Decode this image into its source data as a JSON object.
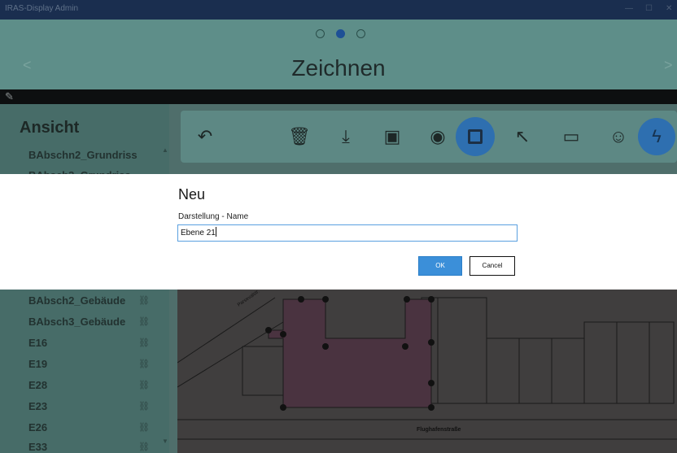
{
  "window": {
    "title": "IRAS-Display Admin",
    "controls": [
      "—",
      "☐",
      "✕"
    ]
  },
  "header": {
    "title": "Zeichnen",
    "pager": {
      "count": 3,
      "active_index": 1
    },
    "prev_label": "<",
    "next_label": ">"
  },
  "toolbar_strip": {
    "icon": "pencil-icon"
  },
  "sidebar": {
    "title": "Ansicht",
    "items": [
      {
        "label": "BAbschn2_Grundriss",
        "linked": false
      },
      {
        "label": "BAbsch3_Grundriss",
        "linked": false
      },
      {
        "label": "BAbsch2_Gebäude",
        "linked": true
      },
      {
        "label": "BAbsch3_Gebäude",
        "linked": true
      },
      {
        "label": "E16",
        "linked": true
      },
      {
        "label": "E19",
        "linked": true
      },
      {
        "label": "E28",
        "linked": true
      },
      {
        "label": "E23",
        "linked": true
      },
      {
        "label": "E26",
        "linked": true
      },
      {
        "label": "E33",
        "linked": true
      }
    ]
  },
  "tools": [
    {
      "name": "undo-icon",
      "active": false
    },
    {
      "name": "trash-icon",
      "active": false
    },
    {
      "name": "save-down-icon",
      "active": false
    },
    {
      "name": "save-icon",
      "active": false
    },
    {
      "name": "point-icon",
      "active": false
    },
    {
      "name": "rectangle-icon",
      "active": true
    },
    {
      "name": "pointer-arrow-icon",
      "active": false
    },
    {
      "name": "image-icon",
      "active": false
    },
    {
      "name": "palette-icon",
      "active": false
    },
    {
      "name": "lightning-icon",
      "active": true
    }
  ],
  "floorplan": {
    "street_label": "Flughafenstraße",
    "street_label_2": "Parsevalstr.",
    "highlight_color": "#b04a6e"
  },
  "dialog": {
    "title": "Neu",
    "field_label": "Darstellung - Name",
    "field_value": "Ebene 21",
    "ok_label": "OK",
    "cancel_label": "Cancel"
  },
  "colors": {
    "accent": "#3b8fd9",
    "titlebar": "#1a2e4f",
    "header": "#5e8e89"
  }
}
